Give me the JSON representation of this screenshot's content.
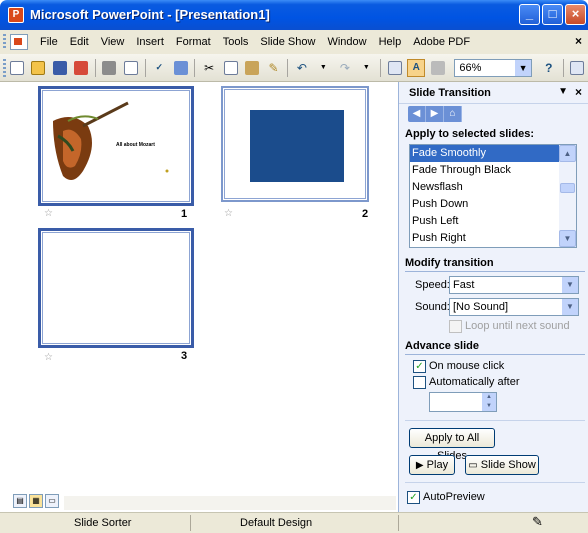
{
  "window": {
    "title": "Microsoft PowerPoint - [Presentation1]",
    "minimize": "_",
    "maximize": "□",
    "close": "×"
  },
  "menubar": {
    "items": [
      "File",
      "Edit",
      "View",
      "Insert",
      "Format",
      "Tools",
      "Slide Show",
      "Window",
      "Help",
      "Adobe PDF"
    ],
    "close": "×"
  },
  "toolbar": {
    "zoom_value": "66%"
  },
  "slides": [
    {
      "number": "1",
      "title_text": "All about Mozart"
    },
    {
      "number": "2"
    },
    {
      "number": "3"
    }
  ],
  "task_pane": {
    "title": "Slide Transition",
    "apply_heading": "Apply to selected slides:",
    "transitions": [
      "Fade Smoothly",
      "Fade Through Black",
      "Newsflash",
      "Push Down",
      "Push Left",
      "Push Right"
    ],
    "selected_transition": "Fade Smoothly",
    "modify_heading": "Modify transition",
    "speed_label": "Speed:",
    "speed_value": "Fast",
    "sound_label": "Sound:",
    "sound_value": "[No Sound]",
    "loop_label": "Loop until next sound",
    "advance_heading": "Advance slide",
    "on_mouse_click_label": "On mouse click",
    "on_mouse_click_checked": true,
    "auto_after_label": "Automatically after",
    "auto_after_checked": false,
    "apply_all_label": "Apply to All Slides",
    "play_label": "Play",
    "slideshow_label": "Slide Show",
    "autopreview_label": "AutoPreview",
    "autopreview_checked": true
  },
  "statusbar": {
    "view": "Slide Sorter",
    "design": "Default Design"
  },
  "colors": {
    "titlebar": "#0054e3",
    "selection": "#316ac5",
    "slide2_fill": "#1b4c8c"
  }
}
